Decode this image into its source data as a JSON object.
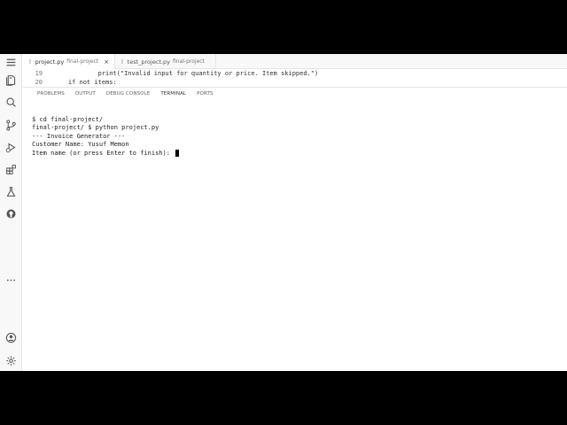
{
  "tabs": [
    {
      "icon": "py",
      "name": "project.py",
      "desc": "final-project",
      "close": "×",
      "active": true
    },
    {
      "icon": "py",
      "name": "test_project.py",
      "desc": "final-project",
      "active": false
    }
  ],
  "editor": {
    "lines": [
      {
        "num": "19",
        "code": "            print(\"Invalid input for quantity or price. Item skipped.\")"
      },
      {
        "num": "20",
        "code": "    if not items:"
      }
    ]
  },
  "panel": {
    "tabs": [
      "PROBLEMS",
      "OUTPUT",
      "DEBUG CONSOLE",
      "TERMINAL",
      "PORTS"
    ],
    "active": "TERMINAL"
  },
  "terminal": {
    "lines": [
      "$ cd final-project/",
      "final-project/ $ python project.py",
      "--- Invoice Generator ---",
      "Customer Name: Yusuf Memon",
      "Item name (or press Enter to finish): "
    ]
  },
  "activity": {
    "icons": [
      "menu-icon",
      "files-icon",
      "search-icon",
      "source-control-icon",
      "run-debug-icon",
      "extensions-icon",
      "testing-icon",
      "github-icon",
      "more-icon",
      "account-icon",
      "settings-icon"
    ]
  }
}
